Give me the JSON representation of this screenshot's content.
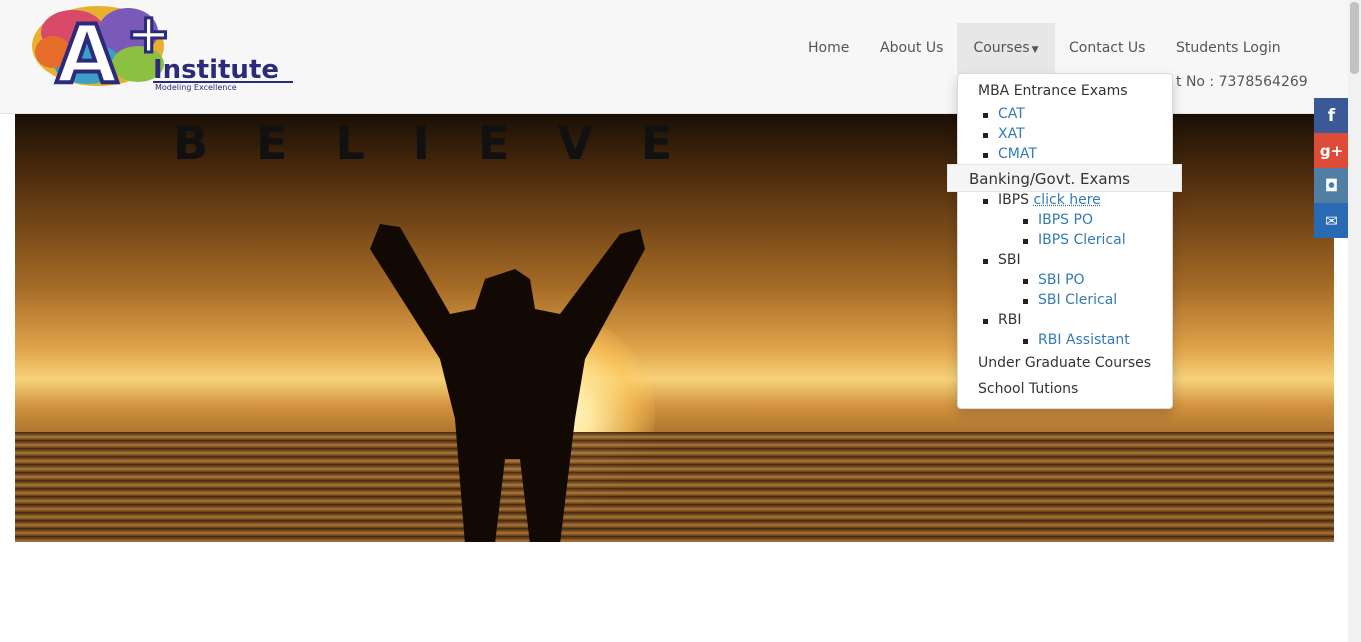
{
  "logo": {
    "main": "A",
    "plus": "+",
    "name": "Institute",
    "tagline": "Modeling Excellence"
  },
  "nav": {
    "home": "Home",
    "about": "About Us",
    "courses": "Courses",
    "contact": "Contact Us",
    "login": "Students Login"
  },
  "contact_line": "t No : 7378564269",
  "hero": {
    "text": "BELIEVE"
  },
  "dropdown": {
    "mba_heading": "MBA Entrance Exams",
    "mba_items": [
      "CAT",
      "XAT",
      "CMAT"
    ],
    "banking_heading": "Banking/Govt. Exams",
    "ibps_label": "IBPS",
    "ibps_link": "click here",
    "ibps_items": [
      "IBPS PO",
      "IBPS Clerical"
    ],
    "sbi_label": "SBI",
    "sbi_items": [
      "SBI PO",
      "SBI Clerical"
    ],
    "rbi_label": "RBI",
    "rbi_items": [
      "RBI Assistant"
    ],
    "ug_heading": "Under Graduate Courses",
    "school_heading": "School Tutions"
  },
  "social": [
    {
      "icon": "facebook-icon",
      "glyph": "f",
      "color": "#3b5998"
    },
    {
      "icon": "google-plus-icon",
      "glyph": "g+",
      "color": "#dd4b39"
    },
    {
      "icon": "instagram-icon",
      "glyph": "◘",
      "color": "#517fa4"
    },
    {
      "icon": "mail-icon",
      "glyph": "✉",
      "color": "#2a6ab5"
    }
  ]
}
